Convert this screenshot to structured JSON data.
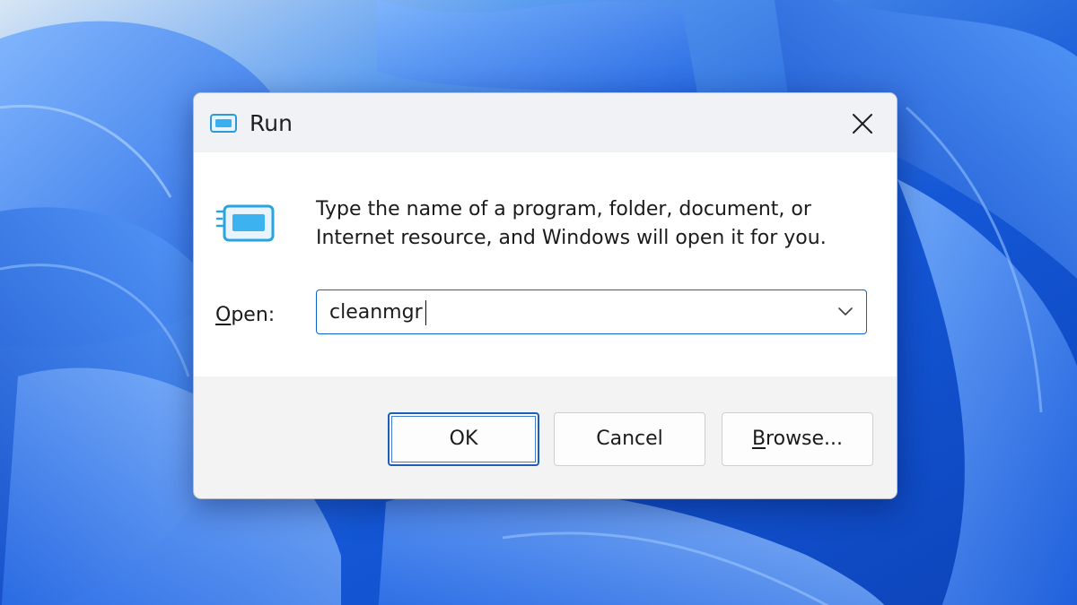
{
  "window": {
    "title": "Run",
    "close_icon": "close-icon",
    "app_icon": "run-icon"
  },
  "dialog": {
    "description": "Type the name of a program, folder, document, or Internet resource, and Windows will open it for you.",
    "open_label_mnemonic": "O",
    "open_label_rest": "pen:",
    "open_value": "cleanmgr"
  },
  "buttons": {
    "ok_label": "OK",
    "cancel_label": "Cancel",
    "browse_mnemonic": "B",
    "browse_rest": "rowse..."
  },
  "colors": {
    "accent": "#0a63c9",
    "wallpaper": "#1a5fd6"
  }
}
